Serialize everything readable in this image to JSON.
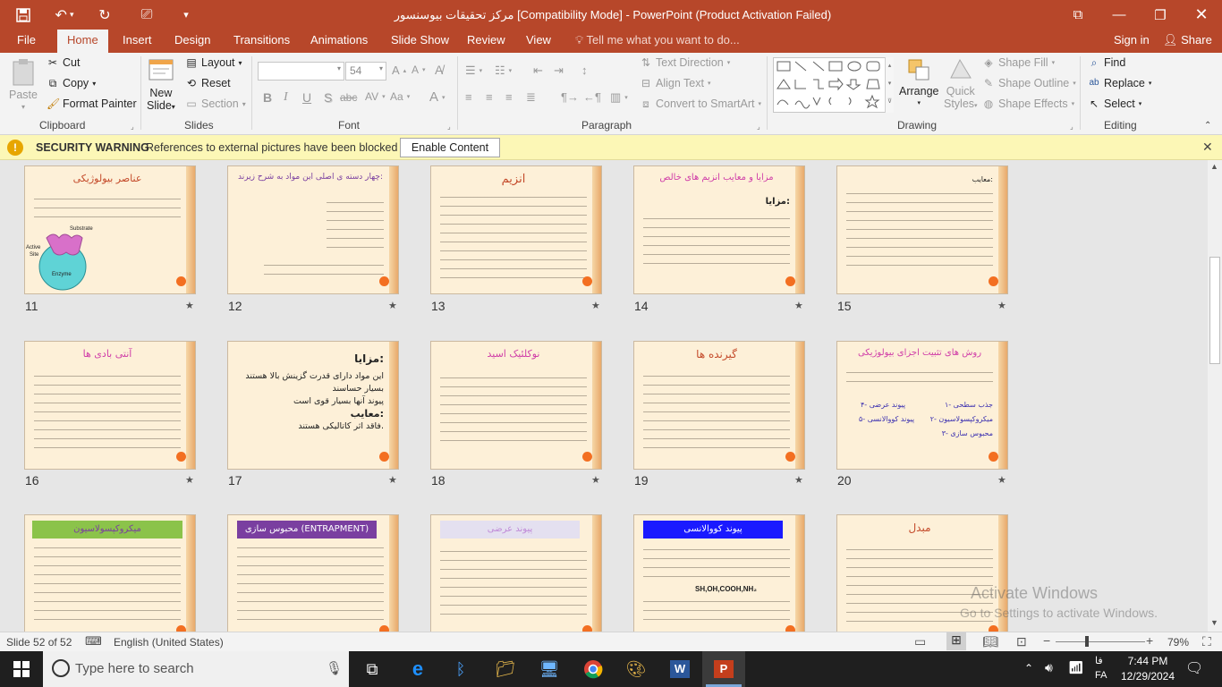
{
  "window": {
    "title": "مرکز تحقیقات بیوسنسور [Compatibility Mode] - PowerPoint (Product Activation Failed)"
  },
  "tabs": [
    "File",
    "Home",
    "Insert",
    "Design",
    "Transitions",
    "Animations",
    "Slide Show",
    "Review",
    "View"
  ],
  "active_tab": "Home",
  "tell_me": "Tell me what you want to do...",
  "account": {
    "sign_in": "Sign in",
    "share": "Share"
  },
  "ribbon": {
    "clipboard": {
      "paste": "Paste",
      "cut": "Cut",
      "copy": "Copy",
      "format_painter": "Format Painter",
      "label": "Clipboard"
    },
    "slides": {
      "new_slide_1": "New",
      "new_slide_2": "Slide",
      "layout": "Layout",
      "reset": "Reset",
      "section": "Section",
      "label": "Slides"
    },
    "font": {
      "size": "54",
      "label": "Font",
      "bold": "B",
      "italic": "I",
      "underline": "U",
      "strike": "S",
      "abc": "abc"
    },
    "paragraph": {
      "text_direction": "Text Direction",
      "align_text": "Align Text",
      "convert_smartart": "Convert to SmartArt",
      "label": "Paragraph"
    },
    "drawing": {
      "arrange": "Arrange",
      "quick_styles_1": "Quick",
      "quick_styles_2": "Styles",
      "shape_fill": "Shape Fill",
      "shape_outline": "Shape Outline",
      "shape_effects": "Shape Effects",
      "label": "Drawing"
    },
    "editing": {
      "find": "Find",
      "replace": "Replace",
      "select": "Select",
      "label": "Editing"
    }
  },
  "security": {
    "title": "SECURITY WARNING",
    "message": "References to external pictures have been blocked",
    "button": "Enable Content"
  },
  "slides": [
    {
      "num": "11",
      "title": "عناصر بیولوژیکی",
      "img_sub": "Substrate",
      "img_active": "Active",
      "img_site": "Site",
      "img_enzyme": "Enzyme"
    },
    {
      "num": "12",
      "title": "چهار دسته ی اصلی این مواد به شرح زیرند:"
    },
    {
      "num": "13",
      "title": "آنزیم"
    },
    {
      "num": "14",
      "title": "مزایا و معایب آنزیم های خالص",
      "sub": "مزایا:"
    },
    {
      "num": "15",
      "title": "معایب:"
    },
    {
      "num": "16",
      "title": "آنتی بادی ها"
    },
    {
      "num": "17",
      "title": "مزایا:",
      "l1": "این مواد دارای قدرت گزینش بالا هستند",
      "l2": "بسیار حساسند",
      "l3": "پیوند آنها بسیار قوی است",
      "sub": "معایب:",
      "l4": "فاقد اثر کاتالیکی هستند."
    },
    {
      "num": "18",
      "title": "نوکلئیک اسید"
    },
    {
      "num": "19",
      "title": "گیرنده ها"
    },
    {
      "num": "20",
      "title": "روش های تثبیت اجزای بیولوژیکی",
      "m1": "۱- جذب سطحی",
      "m2": "۲- میکروکپسولاسیون",
      "m3": "۳- محبوس سازی",
      "m4": "۴- پیوند عرضی",
      "m5": "۵- پیوند کووالانسی"
    },
    {
      "num": "21",
      "title": "میکروکپسولاسیون"
    },
    {
      "num": "22",
      "title": "محبوس سازی (ENTRAPMENT)"
    },
    {
      "num": "23",
      "title": "پیوند عرضی"
    },
    {
      "num": "24",
      "title": "پیوند کووالانسی",
      "chem": "SH,OH,COOH,NH₂"
    },
    {
      "num": "25",
      "title": "مبدل"
    }
  ],
  "watermark": {
    "line1": "Activate Windows",
    "line2": "Go to Settings to activate Windows."
  },
  "status": {
    "slide": "Slide 52 of 52",
    "language": "English (United States)",
    "zoom": "79%"
  },
  "taskbar": {
    "search": "Type here to search",
    "time": "7:44 PM",
    "date": "12/29/2024",
    "lang": "FA",
    "lang2": "فا"
  }
}
